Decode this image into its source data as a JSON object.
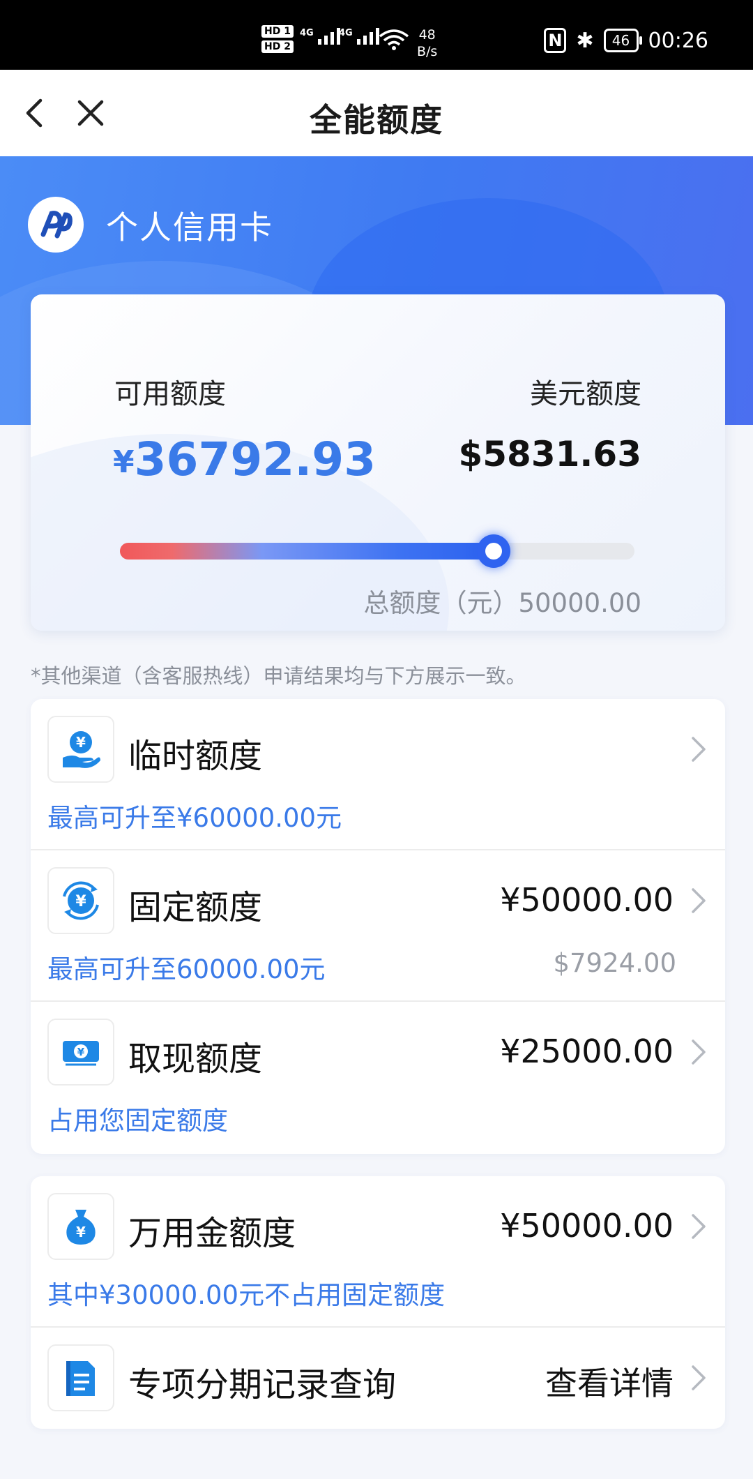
{
  "status_bar": {
    "sim1": "HD 1",
    "sim2": "HD 2",
    "net1": "4G",
    "net2": "4G",
    "speed_value": "48",
    "speed_unit": "B/s",
    "nfc": "N",
    "bluetooth": "✱",
    "battery": "46",
    "time": "00:26"
  },
  "nav": {
    "title": "全能额度",
    "back_icon": "chevron-left-icon",
    "close_icon": "close-icon"
  },
  "brand": {
    "name": "个人信用卡",
    "logo_icon": "bank-logo-icon"
  },
  "limits": {
    "available_label": "可用额度",
    "available_currency": "¥",
    "available_value": "36792.93",
    "usd_label": "美元额度",
    "usd_value": "$5831.63",
    "total_label": "总额度（元）50000.00",
    "usage_fraction": 0.726
  },
  "disclaimer": "*其他渠道（含客服热线）申请结果均与下方展示一致。",
  "items": [
    {
      "title": "临时额度",
      "value": "",
      "sub": "最高可升至¥60000.00元",
      "sub2": "",
      "icon": "hand-yuan-icon"
    },
    {
      "title": "固定额度",
      "value": "¥50000.00",
      "sub": "最高可升至60000.00元",
      "sub2": "$7924.00",
      "icon": "yuan-cycle-icon"
    },
    {
      "title": "取现额度",
      "value": "¥25000.00",
      "sub": "占用您固定额度",
      "sub2": "",
      "icon": "cash-note-icon"
    }
  ],
  "items2": [
    {
      "title": "万用金额度",
      "value": "¥50000.00",
      "sub": "其中¥30000.00元不占用固定额度",
      "icon": "money-bag-icon"
    },
    {
      "title": "专项分期记录查询",
      "value": "查看详情",
      "icon": "document-icon"
    }
  ],
  "colors": {
    "accent": "#3a7ae8",
    "hero": "#4580f4",
    "slider_knob": "#2f63f0"
  }
}
